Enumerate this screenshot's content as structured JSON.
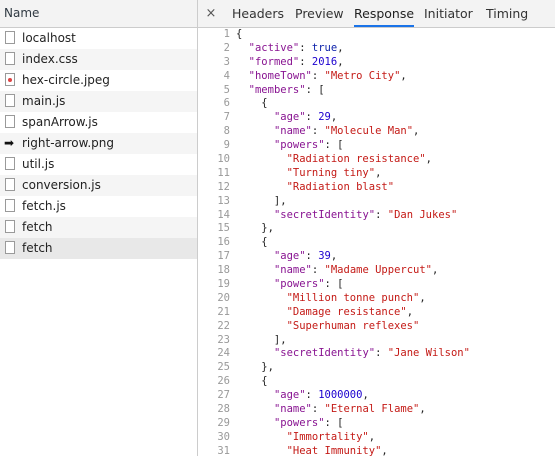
{
  "network": {
    "header_title": "Name",
    "files": [
      {
        "name": "localhost",
        "icon": "document-icon"
      },
      {
        "name": "index.css",
        "icon": "document-icon"
      },
      {
        "name": "hex-circle.jpeg",
        "icon": "image-icon"
      },
      {
        "name": "main.js",
        "icon": "document-icon"
      },
      {
        "name": "spanArrow.js",
        "icon": "document-icon"
      },
      {
        "name": "right-arrow.png",
        "icon": "arrow-image-icon"
      },
      {
        "name": "util.js",
        "icon": "document-icon"
      },
      {
        "name": "conversion.js",
        "icon": "document-icon"
      },
      {
        "name": "fetch.js",
        "icon": "document-icon"
      },
      {
        "name": "fetch",
        "icon": "document-icon"
      },
      {
        "name": "fetch",
        "icon": "document-icon"
      }
    ]
  },
  "details": {
    "close_label": "×",
    "tabs": [
      "Headers",
      "Preview",
      "Response",
      "Initiator",
      "Timing"
    ],
    "active_tab": "Response"
  },
  "response": {
    "lines": [
      [
        {
          "t": "{",
          "c": "p"
        }
      ],
      [
        {
          "t": "  ",
          "c": "p"
        },
        {
          "t": "\"active\"",
          "c": "k"
        },
        {
          "t": ": ",
          "c": "p"
        },
        {
          "t": "true",
          "c": "b"
        },
        {
          "t": ",",
          "c": "p"
        }
      ],
      [
        {
          "t": "  ",
          "c": "p"
        },
        {
          "t": "\"formed\"",
          "c": "k"
        },
        {
          "t": ": ",
          "c": "p"
        },
        {
          "t": "2016",
          "c": "n"
        },
        {
          "t": ",",
          "c": "p"
        }
      ],
      [
        {
          "t": "  ",
          "c": "p"
        },
        {
          "t": "\"homeTown\"",
          "c": "k"
        },
        {
          "t": ": ",
          "c": "p"
        },
        {
          "t": "\"Metro City\"",
          "c": "s"
        },
        {
          "t": ",",
          "c": "p"
        }
      ],
      [
        {
          "t": "  ",
          "c": "p"
        },
        {
          "t": "\"members\"",
          "c": "k"
        },
        {
          "t": ": [",
          "c": "p"
        }
      ],
      [
        {
          "t": "    {",
          "c": "p"
        }
      ],
      [
        {
          "t": "      ",
          "c": "p"
        },
        {
          "t": "\"age\"",
          "c": "k"
        },
        {
          "t": ": ",
          "c": "p"
        },
        {
          "t": "29",
          "c": "n"
        },
        {
          "t": ",",
          "c": "p"
        }
      ],
      [
        {
          "t": "      ",
          "c": "p"
        },
        {
          "t": "\"name\"",
          "c": "k"
        },
        {
          "t": ": ",
          "c": "p"
        },
        {
          "t": "\"Molecule Man\"",
          "c": "s"
        },
        {
          "t": ",",
          "c": "p"
        }
      ],
      [
        {
          "t": "      ",
          "c": "p"
        },
        {
          "t": "\"powers\"",
          "c": "k"
        },
        {
          "t": ": [",
          "c": "p"
        }
      ],
      [
        {
          "t": "        ",
          "c": "p"
        },
        {
          "t": "\"Radiation resistance\"",
          "c": "s"
        },
        {
          "t": ",",
          "c": "p"
        }
      ],
      [
        {
          "t": "        ",
          "c": "p"
        },
        {
          "t": "\"Turning tiny\"",
          "c": "s"
        },
        {
          "t": ",",
          "c": "p"
        }
      ],
      [
        {
          "t": "        ",
          "c": "p"
        },
        {
          "t": "\"Radiation blast\"",
          "c": "s"
        }
      ],
      [
        {
          "t": "      ],",
          "c": "p"
        }
      ],
      [
        {
          "t": "      ",
          "c": "p"
        },
        {
          "t": "\"secretIdentity\"",
          "c": "k"
        },
        {
          "t": ": ",
          "c": "p"
        },
        {
          "t": "\"Dan Jukes\"",
          "c": "s"
        }
      ],
      [
        {
          "t": "    },",
          "c": "p"
        }
      ],
      [
        {
          "t": "    {",
          "c": "p"
        }
      ],
      [
        {
          "t": "      ",
          "c": "p"
        },
        {
          "t": "\"age\"",
          "c": "k"
        },
        {
          "t": ": ",
          "c": "p"
        },
        {
          "t": "39",
          "c": "n"
        },
        {
          "t": ",",
          "c": "p"
        }
      ],
      [
        {
          "t": "      ",
          "c": "p"
        },
        {
          "t": "\"name\"",
          "c": "k"
        },
        {
          "t": ": ",
          "c": "p"
        },
        {
          "t": "\"Madame Uppercut\"",
          "c": "s"
        },
        {
          "t": ",",
          "c": "p"
        }
      ],
      [
        {
          "t": "      ",
          "c": "p"
        },
        {
          "t": "\"powers\"",
          "c": "k"
        },
        {
          "t": ": [",
          "c": "p"
        }
      ],
      [
        {
          "t": "        ",
          "c": "p"
        },
        {
          "t": "\"Million tonne punch\"",
          "c": "s"
        },
        {
          "t": ",",
          "c": "p"
        }
      ],
      [
        {
          "t": "        ",
          "c": "p"
        },
        {
          "t": "\"Damage resistance\"",
          "c": "s"
        },
        {
          "t": ",",
          "c": "p"
        }
      ],
      [
        {
          "t": "        ",
          "c": "p"
        },
        {
          "t": "\"Superhuman reflexes\"",
          "c": "s"
        }
      ],
      [
        {
          "t": "      ],",
          "c": "p"
        }
      ],
      [
        {
          "t": "      ",
          "c": "p"
        },
        {
          "t": "\"secretIdentity\"",
          "c": "k"
        },
        {
          "t": ": ",
          "c": "p"
        },
        {
          "t": "\"Jane Wilson\"",
          "c": "s"
        }
      ],
      [
        {
          "t": "    },",
          "c": "p"
        }
      ],
      [
        {
          "t": "    {",
          "c": "p"
        }
      ],
      [
        {
          "t": "      ",
          "c": "p"
        },
        {
          "t": "\"age\"",
          "c": "k"
        },
        {
          "t": ": ",
          "c": "p"
        },
        {
          "t": "1000000",
          "c": "n"
        },
        {
          "t": ",",
          "c": "p"
        }
      ],
      [
        {
          "t": "      ",
          "c": "p"
        },
        {
          "t": "\"name\"",
          "c": "k"
        },
        {
          "t": ": ",
          "c": "p"
        },
        {
          "t": "\"Eternal Flame\"",
          "c": "s"
        },
        {
          "t": ",",
          "c": "p"
        }
      ],
      [
        {
          "t": "      ",
          "c": "p"
        },
        {
          "t": "\"powers\"",
          "c": "k"
        },
        {
          "t": ": [",
          "c": "p"
        }
      ],
      [
        {
          "t": "        ",
          "c": "p"
        },
        {
          "t": "\"Immortality\"",
          "c": "s"
        },
        {
          "t": ",",
          "c": "p"
        }
      ],
      [
        {
          "t": "        ",
          "c": "p"
        },
        {
          "t": "\"Heat Immunity\"",
          "c": "s"
        },
        {
          "t": ",",
          "c": "p"
        }
      ]
    ]
  }
}
